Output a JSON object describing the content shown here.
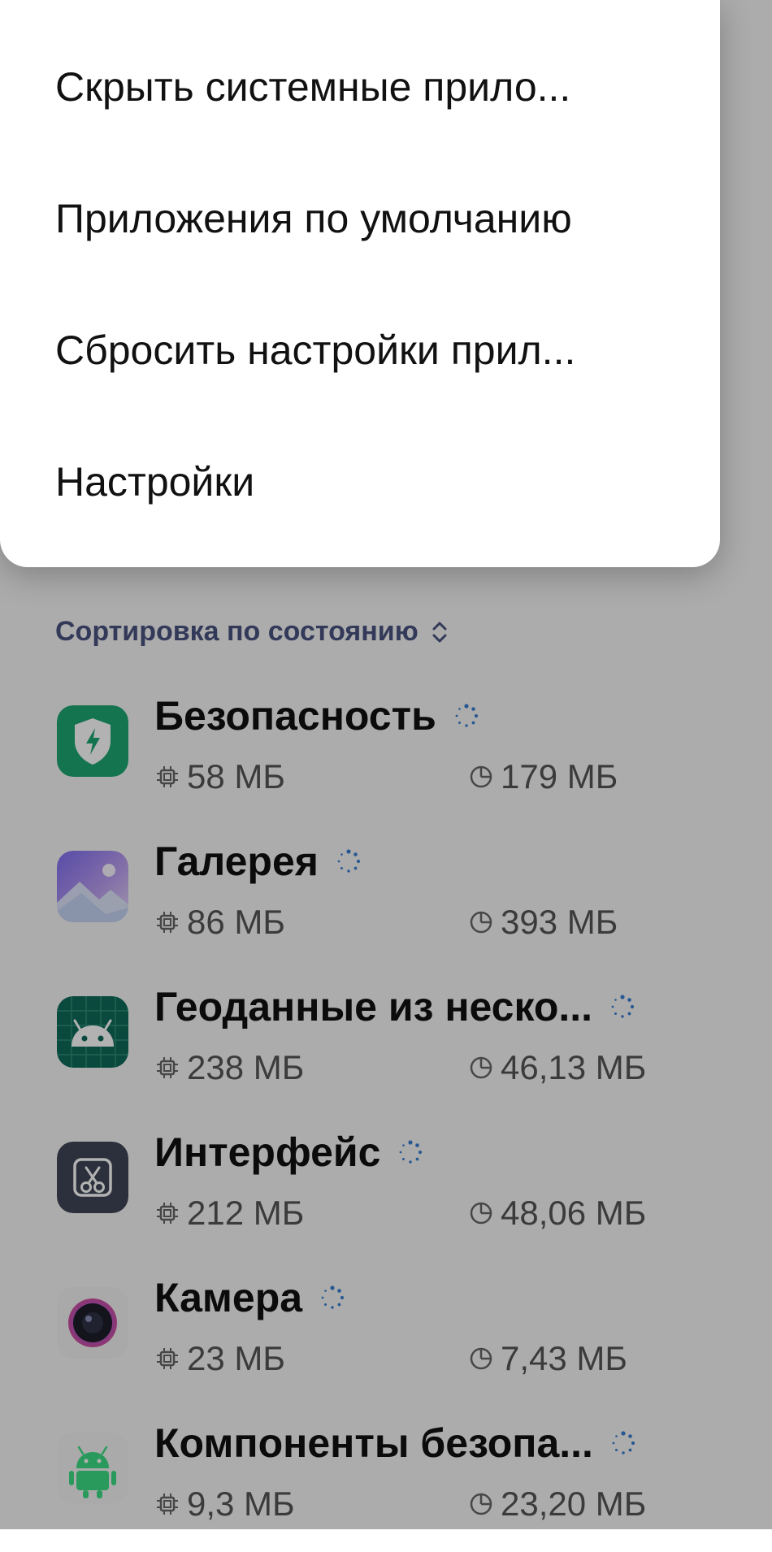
{
  "menu": {
    "items": [
      {
        "label": "Скрыть системные прило..."
      },
      {
        "label": "Приложения по умолчанию"
      },
      {
        "label": "Сбросить настройки прил..."
      },
      {
        "label": "Настройки"
      }
    ]
  },
  "sort": {
    "label": "Сортировка по состоянию",
    "icon": "sort-chevron-icon"
  },
  "apps": [
    {
      "name": "Безопасность",
      "ram": "58 МБ",
      "storage": "179 МБ",
      "icon": "security-shield-icon"
    },
    {
      "name": "Галерея",
      "ram": "86 МБ",
      "storage": "393 МБ",
      "icon": "gallery-icon"
    },
    {
      "name": "Геоданные из неско...",
      "ram": "238 МБ",
      "storage": "46,13 МБ",
      "icon": "android-robot-icon"
    },
    {
      "name": "Интерфейс",
      "ram": "212 МБ",
      "storage": "48,06 МБ",
      "icon": "scissors-icon"
    },
    {
      "name": "Камера",
      "ram": "23 МБ",
      "storage": "7,43 МБ",
      "icon": "camera-lens-icon"
    },
    {
      "name": "Компоненты безопа...",
      "ram": "9,3 МБ",
      "storage": "23,20 МБ",
      "icon": "android-green-icon"
    }
  ],
  "colors": {
    "accent_loading": "#3a7fd0",
    "sort_text": "#4a5480",
    "security_green": "#1fa673",
    "geodata_teal": "#0f6b5a",
    "interface_slate": "#3f4556"
  }
}
